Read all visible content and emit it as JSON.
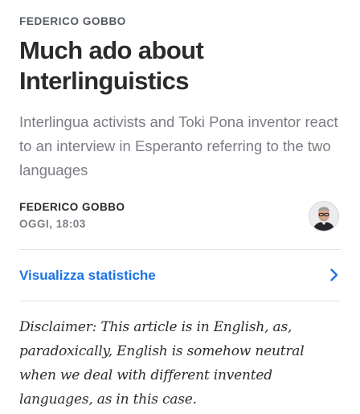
{
  "article": {
    "kicker": "FEDERICO GOBBO",
    "title": "Much ado about Interlinguistics",
    "subtitle": "Interlingua activists and Toki Pona inventor react to an interview in Esperanto referring to the two languages",
    "author": {
      "name": "FEDERICO GOBBO",
      "timestamp": "OGGI, 18:03",
      "avatar_icon": "author-photo"
    },
    "stats_link": {
      "label": "Visualizza statistiche",
      "icon": "chevron-right-icon",
      "color": "#1a73e8"
    },
    "disclaimer": "Disclaimer: This article is in English, as, paradoxically, English is somehow neutral when we deal with different invented languages, as in this case."
  }
}
